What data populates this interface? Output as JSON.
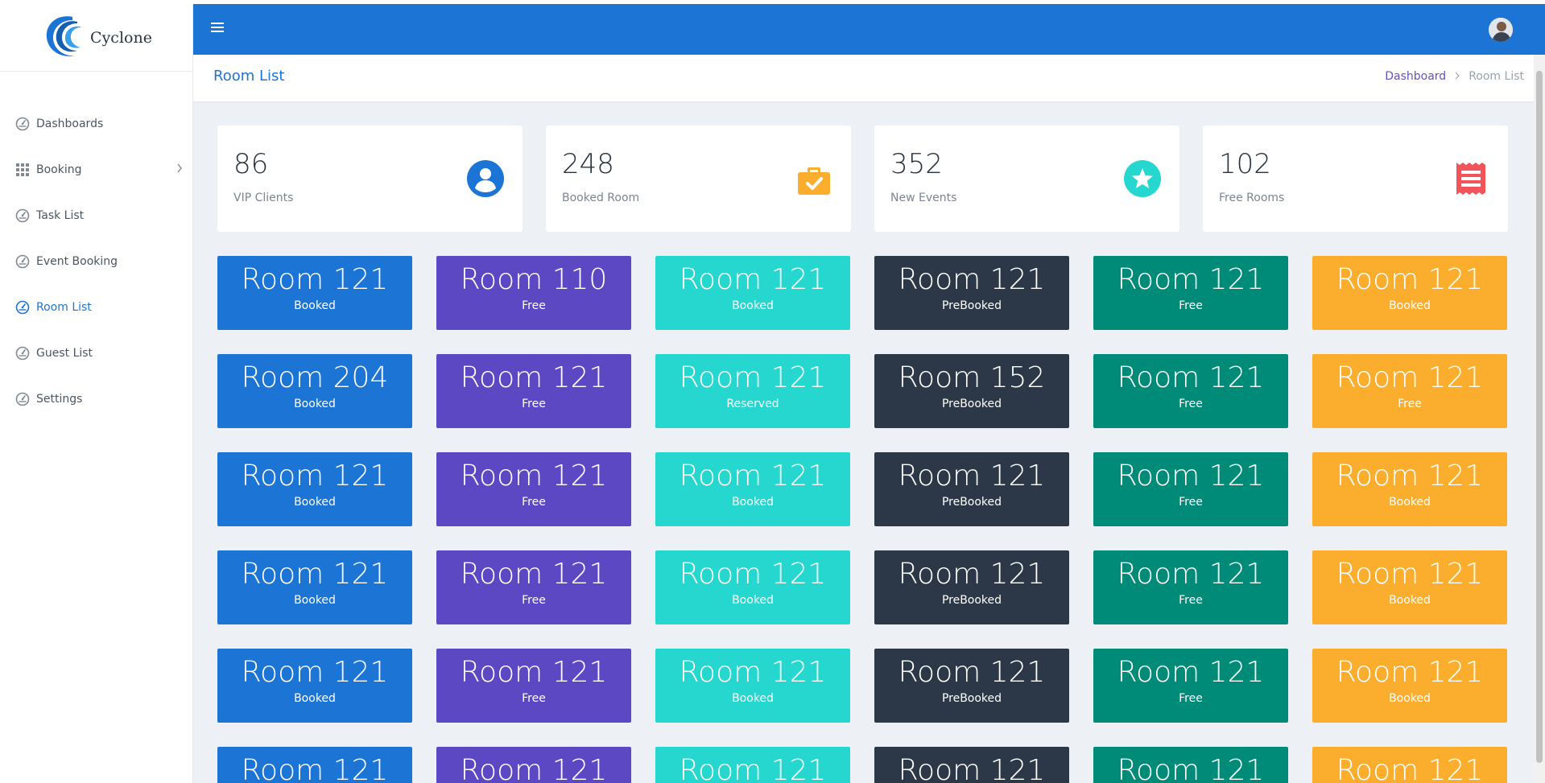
{
  "app": {
    "logo_text": "Cyclone",
    "accent": "#1c74d4"
  },
  "sidebar": {
    "items": [
      {
        "label": "Dashboards",
        "icon": "speedometer-icon"
      },
      {
        "label": "Booking",
        "icon": "grid-icon"
      },
      {
        "label": "Task List",
        "icon": "speedometer-icon"
      },
      {
        "label": "Event Booking",
        "icon": "speedometer-icon"
      },
      {
        "label": "Room List",
        "icon": "speedometer-icon"
      },
      {
        "label": "Guest List",
        "icon": "speedometer-icon"
      },
      {
        "label": "Settings",
        "icon": "speedometer-icon"
      }
    ],
    "active": "Room List"
  },
  "page": {
    "title": "Room List",
    "breadcrumb": {
      "parent": "Dashboard",
      "current": "Room List"
    }
  },
  "stats": [
    {
      "value": "86",
      "label": "VIP Clients",
      "icon": "user-icon",
      "color": "#1c74d4"
    },
    {
      "value": "248",
      "label": "Booked Room",
      "icon": "briefcase-check-icon",
      "color": "#fbae2e"
    },
    {
      "value": "352",
      "label": "New Events",
      "icon": "star-icon",
      "color": "#26d7cf"
    },
    {
      "value": "102",
      "label": "Free Rooms",
      "icon": "receipt-icon",
      "color": "#f2545b"
    }
  ],
  "room_colors": [
    "#1c74d4",
    "#5d48c4",
    "#26d7cf",
    "#2c3847",
    "#008a78",
    "#fbae2e"
  ],
  "rooms": [
    [
      {
        "name": "Room 121",
        "status": "Booked"
      },
      {
        "name": "Room 110",
        "status": "Free"
      },
      {
        "name": "Room 121",
        "status": "Booked"
      },
      {
        "name": "Room 121",
        "status": "PreBooked"
      },
      {
        "name": "Room 121",
        "status": "Free"
      },
      {
        "name": "Room 121",
        "status": "Booked"
      }
    ],
    [
      {
        "name": "Room 204",
        "status": "Booked"
      },
      {
        "name": "Room 121",
        "status": "Free"
      },
      {
        "name": "Room 121",
        "status": "Reserved"
      },
      {
        "name": "Room 152",
        "status": "PreBooked"
      },
      {
        "name": "Room 121",
        "status": "Free"
      },
      {
        "name": "Room 121",
        "status": "Free"
      }
    ],
    [
      {
        "name": "Room 121",
        "status": "Booked"
      },
      {
        "name": "Room 121",
        "status": "Free"
      },
      {
        "name": "Room 121",
        "status": "Booked"
      },
      {
        "name": "Room 121",
        "status": "PreBooked"
      },
      {
        "name": "Room 121",
        "status": "Free"
      },
      {
        "name": "Room 121",
        "status": "Booked"
      }
    ],
    [
      {
        "name": "Room 121",
        "status": "Booked"
      },
      {
        "name": "Room 121",
        "status": "Free"
      },
      {
        "name": "Room 121",
        "status": "Booked"
      },
      {
        "name": "Room 121",
        "status": "PreBooked"
      },
      {
        "name": "Room 121",
        "status": "Free"
      },
      {
        "name": "Room 121",
        "status": "Booked"
      }
    ],
    [
      {
        "name": "Room 121",
        "status": "Booked"
      },
      {
        "name": "Room 121",
        "status": "Free"
      },
      {
        "name": "Room 121",
        "status": "Booked"
      },
      {
        "name": "Room 121",
        "status": "PreBooked"
      },
      {
        "name": "Room 121",
        "status": "Free"
      },
      {
        "name": "Room 121",
        "status": "Booked"
      }
    ],
    [
      {
        "name": "Room 121",
        "status": ""
      },
      {
        "name": "Room 121",
        "status": ""
      },
      {
        "name": "Room 121",
        "status": ""
      },
      {
        "name": "Room 121",
        "status": ""
      },
      {
        "name": "Room 121",
        "status": ""
      },
      {
        "name": "Room 121",
        "status": ""
      }
    ]
  ]
}
